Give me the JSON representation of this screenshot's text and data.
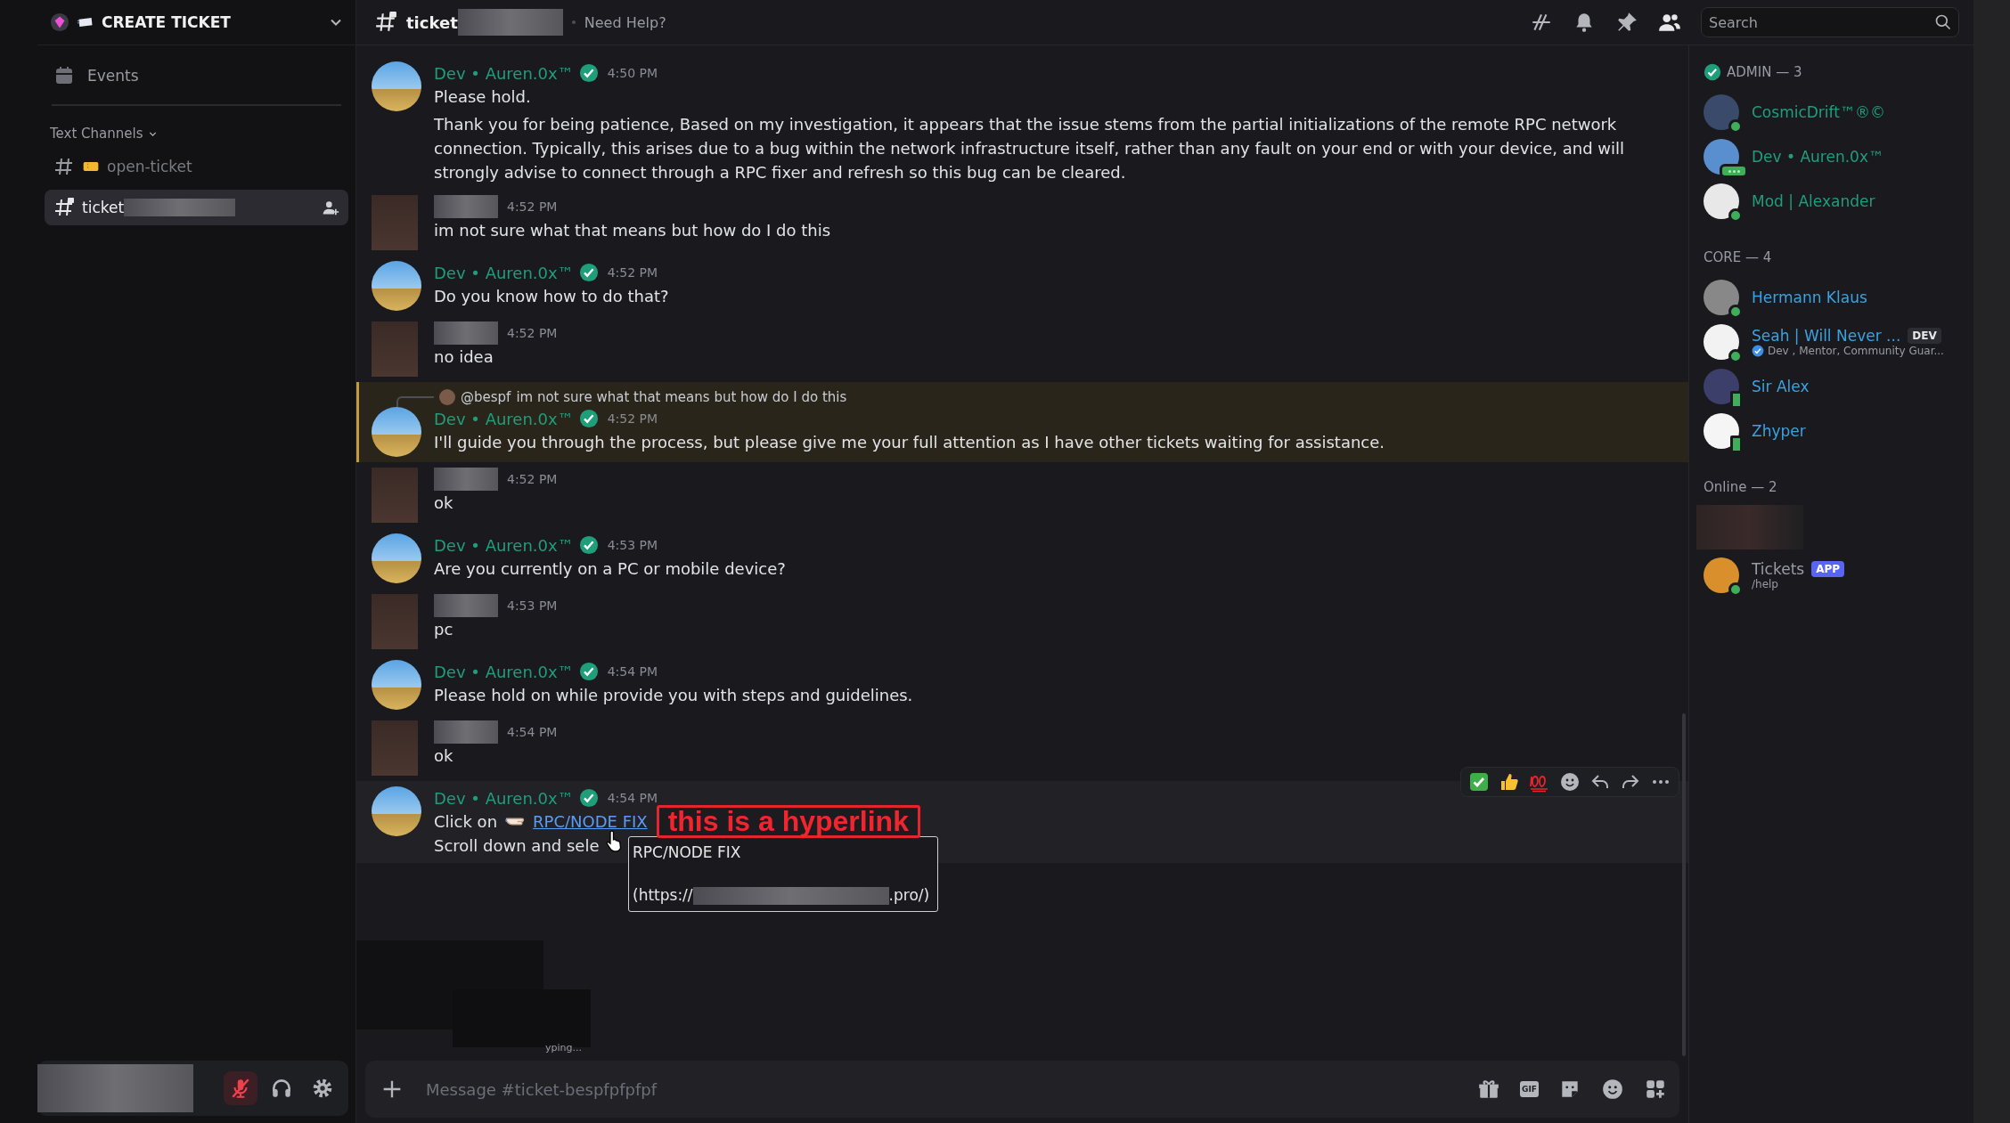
{
  "server": {
    "name": "CREATE TICKET"
  },
  "sidebar": {
    "items": [
      {
        "kind": "events",
        "label": "Events"
      }
    ],
    "category": {
      "label": "Text Channels",
      "expanded": true
    },
    "channels": [
      {
        "label": "open-ticket",
        "selected": false,
        "redacted": false
      },
      {
        "label": "ticket",
        "selected": true,
        "redacted": true
      }
    ]
  },
  "user_panel": {
    "muted": true
  },
  "channel_header": {
    "name": "ticket",
    "topic": "Need Help?"
  },
  "search": {
    "placeholder": "Search"
  },
  "messages": [
    {
      "kind": "staff",
      "author": "Dev • Auren.0x™",
      "time": "4:50 PM",
      "highlighted": false,
      "hovered": false,
      "lines": [
        "Please hold.",
        "Thank you for being patience, Based on my investigation, it appears that the issue stems from the partial initializations of the remote RPC network connection. Typically, this arises due to a bug within the network infrastructure itself, rather than any fault on your end or with your device, and will strongly advise to connect through a RPC fixer and refresh so this bug can be cleared."
      ]
    },
    {
      "kind": "user",
      "time": "4:52 PM",
      "highlighted": false,
      "hovered": false,
      "lines": [
        "im not sure what that means but how do I do this"
      ]
    },
    {
      "kind": "staff",
      "author": "Dev • Auren.0x™",
      "time": "4:52 PM",
      "highlighted": false,
      "hovered": false,
      "lines": [
        "Do you know how to do that?"
      ]
    },
    {
      "kind": "user",
      "time": "4:52 PM",
      "highlighted": false,
      "hovered": false,
      "lines": [
        "no idea"
      ]
    },
    {
      "kind": "staff",
      "author": "Dev • Auren.0x™",
      "time": "4:52 PM",
      "highlighted": true,
      "hovered": false,
      "reply": {
        "mention": "@bespf",
        "text": "im not sure what that means but how do I do this"
      },
      "lines": [
        "I'll guide you through the process, but please give me your full attention as I have other tickets waiting for assistance."
      ]
    },
    {
      "kind": "user",
      "time": "4:52 PM",
      "highlighted": false,
      "hovered": false,
      "lines": [
        "ok"
      ]
    },
    {
      "kind": "staff",
      "author": "Dev • Auren.0x™",
      "time": "4:53 PM",
      "highlighted": false,
      "hovered": false,
      "lines": [
        "Are you currently on a PC or mobile device?"
      ]
    },
    {
      "kind": "user",
      "time": "4:53 PM",
      "highlighted": false,
      "hovered": false,
      "lines": [
        "pc"
      ]
    },
    {
      "kind": "staff",
      "author": "Dev • Auren.0x™",
      "time": "4:54 PM",
      "highlighted": false,
      "hovered": false,
      "lines": [
        "Please hold on while provide you with steps and guidelines."
      ]
    },
    {
      "kind": "user",
      "time": "4:54 PM",
      "highlighted": false,
      "hovered": false,
      "lines": [
        "ok"
      ]
    },
    {
      "kind": "staff",
      "author": "Dev • Auren.0x™",
      "time": "4:54 PM",
      "highlighted": false,
      "hovered": true,
      "link_line": {
        "text": "Click on",
        "link": "RPC/NODE FIX"
      },
      "lines": [
        "Scroll down and sele"
      ]
    }
  ],
  "link_tooltip": {
    "title": "RPC/NODE FIX",
    "url_prefix": "(https://",
    "url_suffix": ".pro/)"
  },
  "annotation": {
    "text": "this is a hyperlink"
  },
  "typing": {
    "text": "yping..."
  },
  "composer": {
    "placeholder": "Message #ticket-bespfpfpfpf",
    "gif_label": "GIF"
  },
  "member_groups": [
    {
      "label": "ADMIN — 3",
      "verified": true,
      "members": [
        {
          "kind": "online",
          "name": "CosmicDrift™®©",
          "color": "#1f9e7a"
        },
        {
          "kind": "typing",
          "name": "Dev • Auren.0x™",
          "color": "#1f9e7a"
        },
        {
          "kind": "online",
          "name": "Mod | Alexander",
          "color": "#1f9e7a"
        }
      ]
    },
    {
      "label": "CORE — 4",
      "verified": false,
      "members": [
        {
          "kind": "online",
          "name": "Hermann Klaus",
          "color": "#3ba2e0"
        },
        {
          "kind": "online",
          "name": "Seah | Will Never ...",
          "color": "#3ba2e0",
          "tag": {
            "kind": "dev",
            "label": "DEV"
          },
          "subtitle": "Dev , Mentor, Community Guar...",
          "subtitle_verified": true
        },
        {
          "kind": "mobile",
          "name": "Sir Alex",
          "color": "#3ba2e0"
        },
        {
          "kind": "mobile",
          "name": "Zhyper",
          "color": "#3ba2e0"
        }
      ]
    },
    {
      "label": "Online — 2",
      "verified": false,
      "members": [
        {
          "kind": "redacted"
        },
        {
          "kind": "online",
          "name": "Tickets",
          "color": "#9b9ca3",
          "tag": {
            "kind": "app",
            "label": "APP"
          },
          "subtitle": "/help",
          "subtitle_verified": false
        }
      ]
    }
  ]
}
